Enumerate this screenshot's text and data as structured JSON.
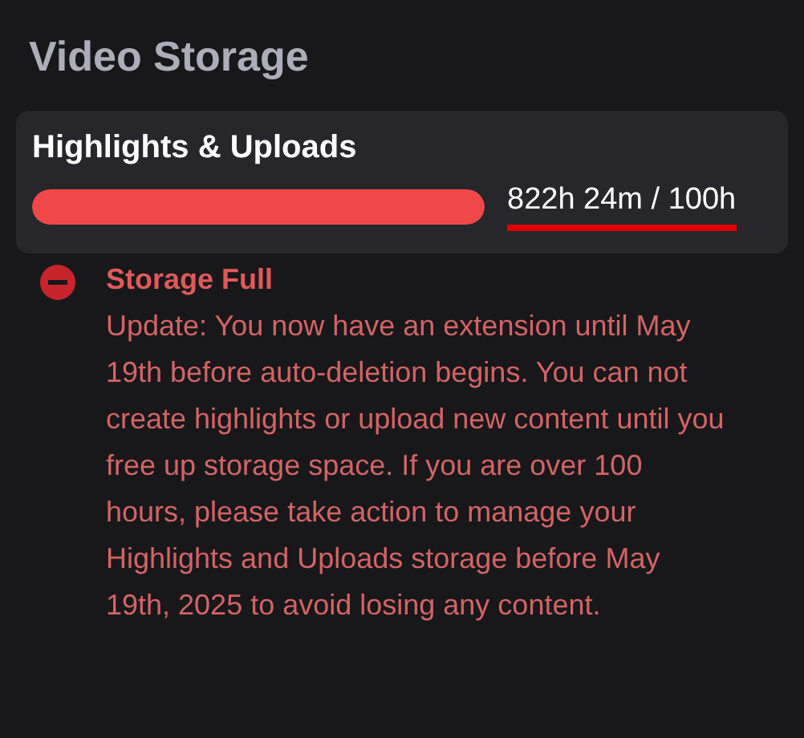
{
  "title": "Video Storage",
  "storage": {
    "label": "Highlights & Uploads",
    "level": 1,
    "reading": "822h 24m / 100h",
    "underlined": true
  },
  "alert": {
    "kind": "error",
    "title": "Storage Full",
    "message": "Update: You now have an extension until May 19th before auto-deletion begins. You can not create highlights or upload new content until you free up storage space. If you are over 100 hours, please take action to manage your Highlights and Uploads storage before May 19th, 2025 to avoid losing any content."
  }
}
